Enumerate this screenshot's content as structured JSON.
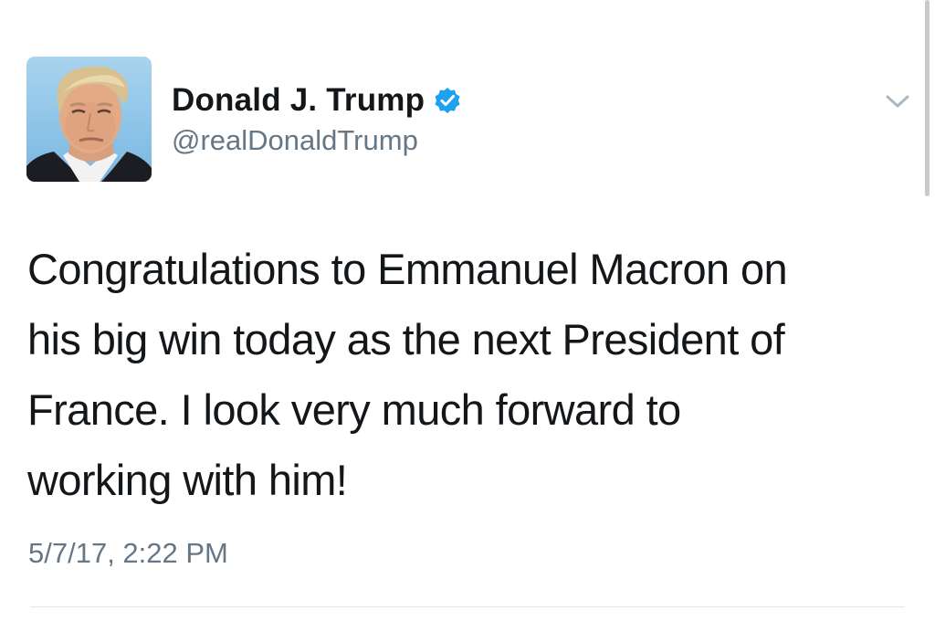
{
  "tweet": {
    "author": {
      "display_name": "Donald J. Trump",
      "handle": "@realDonaldTrump",
      "verified": true,
      "avatar_icon": "profile-photo",
      "verified_color": "#1da1f2"
    },
    "text_lines": [
      "Congratulations to Emmanuel Macron on",
      "his big win today as the next President of",
      "France. I look very much forward to",
      "working with him!"
    ],
    "timestamp": "5/7/17, 2:22 PM",
    "menu_icon": "chevron-down-icon",
    "colors": {
      "text": "#14171a",
      "secondary": "#657786",
      "divider": "#e1e8ed"
    }
  }
}
